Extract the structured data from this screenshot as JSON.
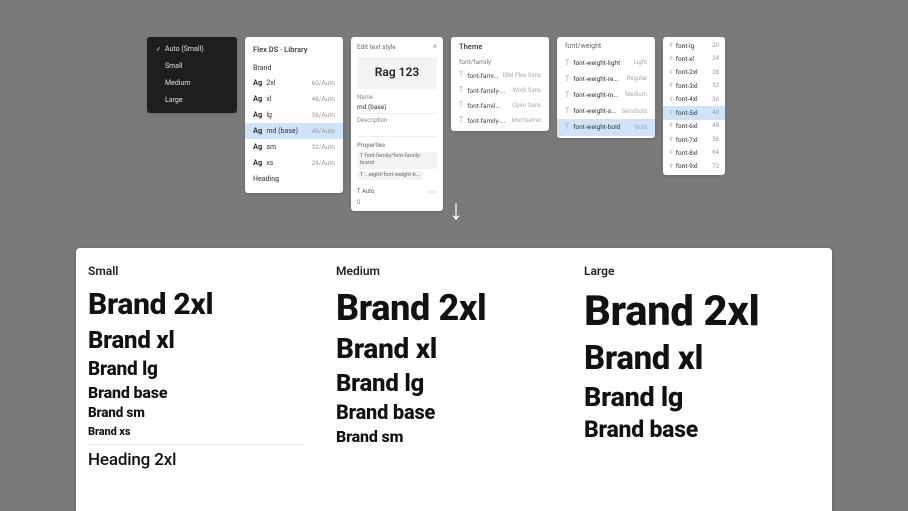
{
  "dropdown": {
    "selected": "Auto (Small)",
    "options": [
      "Small",
      "Medium",
      "Large"
    ]
  },
  "library": {
    "title": "Flex DS · Library",
    "section1": "Brand",
    "rows": [
      {
        "ag": "Ag",
        "name": "2xl",
        "size": "60/Auto",
        "sel": false
      },
      {
        "ag": "Ag",
        "name": "xl",
        "size": "48/Auto",
        "sel": false
      },
      {
        "ag": "Ag",
        "name": "lg",
        "size": "36/Auto",
        "sel": false
      },
      {
        "ag": "Ag",
        "name": "md (base)",
        "size": "40/Auto",
        "sel": true
      },
      {
        "ag": "Ag",
        "name": "sm",
        "size": "32/Auto",
        "sel": false
      },
      {
        "ag": "Ag",
        "name": "xs",
        "size": "24/Auto",
        "sel": false
      }
    ],
    "section2": "Heading"
  },
  "edit": {
    "title": "Edit text style",
    "preview": "Rag 123",
    "name_label": "Name",
    "name_value": "md (base)",
    "desc_label": "Description",
    "props_label": "Properties",
    "chip1": "font-family/font-family-brand",
    "chip2": "...eight/font-weight-b...",
    "auto": "Auto",
    "num": "0"
  },
  "theme": {
    "header": "Theme",
    "section": "font/family",
    "rows": [
      {
        "name": "font-famil...",
        "val": "IBM Plex Sans"
      },
      {
        "name": "font-family-...",
        "val": "Work Sans"
      },
      {
        "name": "font-famil...",
        "val": "Open Sans"
      },
      {
        "name": "font-family-...",
        "val": "Montserrat"
      }
    ]
  },
  "weight": {
    "header": "font/weight",
    "rows": [
      {
        "name": "font-weight-light",
        "val": "Light",
        "sel": false
      },
      {
        "name": "font-weight-re...",
        "val": "Regular",
        "sel": false
      },
      {
        "name": "font-weight-m...",
        "val": "Medium",
        "sel": false
      },
      {
        "name": "font-weight-s...",
        "val": "SemiBold",
        "sel": false
      },
      {
        "name": "font-weight-bold",
        "val": "Bold",
        "sel": true
      }
    ]
  },
  "sizes": {
    "rows": [
      {
        "name": "font-lg",
        "val": "20",
        "sel": false
      },
      {
        "name": "font-xl",
        "val": "24",
        "sel": false
      },
      {
        "name": "font-2xl",
        "val": "28",
        "sel": false
      },
      {
        "name": "font-3xl",
        "val": "32",
        "sel": false
      },
      {
        "name": "font-4xl",
        "val": "36",
        "sel": false
      },
      {
        "name": "font-5xl",
        "val": "40",
        "sel": true
      },
      {
        "name": "font-6xl",
        "val": "48",
        "sel": false
      },
      {
        "name": "font-7xl",
        "val": "56",
        "sel": false
      },
      {
        "name": "font-8xl",
        "val": "64",
        "sel": false
      },
      {
        "name": "font-9xl",
        "val": "72",
        "sel": false
      }
    ]
  },
  "output": {
    "small": {
      "title": "Small",
      "items": [
        "Brand 2xl",
        "Brand xl",
        "Brand lg",
        "Brand base",
        "Brand sm",
        "Brand xs"
      ],
      "heading": "Heading 2xl"
    },
    "medium": {
      "title": "Medium",
      "items": [
        "Brand 2xl",
        "Brand xl",
        "Brand lg",
        "Brand base",
        "Brand sm"
      ]
    },
    "large": {
      "title": "Large",
      "items": [
        "Brand 2xl",
        "Brand xl",
        "Brand lg",
        "Brand base"
      ]
    }
  }
}
